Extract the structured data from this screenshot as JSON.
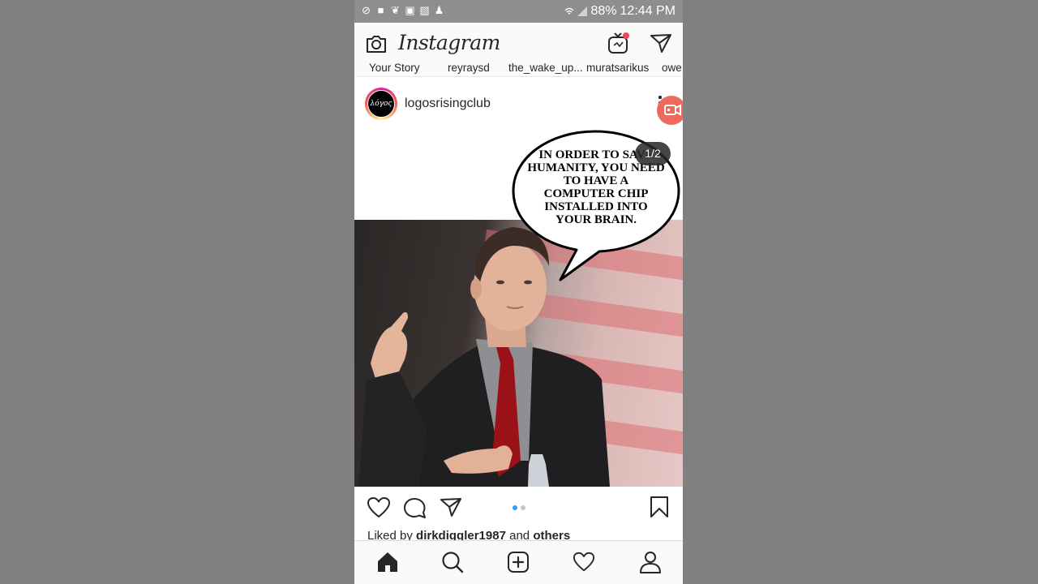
{
  "status_bar": {
    "battery": "88%",
    "time": "12:44 PM",
    "left_icons": [
      "do-not-disturb-icon",
      "video-icon",
      "twitter-icon",
      "clipboard-icon",
      "photo-icon",
      "chess-icon"
    ]
  },
  "header": {
    "logo_text": "Instagram",
    "igtv_badge_color": "#ed4956"
  },
  "stories": [
    {
      "label": "Your Story"
    },
    {
      "label": "reyraysd"
    },
    {
      "label": "the_wake_up..."
    },
    {
      "label": "muratsarikus"
    },
    {
      "label": "owe"
    }
  ],
  "post": {
    "avatar_text": "λόγος",
    "username": "logosrisingclub",
    "counter": "1/2",
    "speech_bubble": "IN ORDER TO SAVE HUMANITY, YOU NEED TO HAVE A COMPUTER CHIP INSTALLED INTO YOUR BRAIN.",
    "carousel_active": 1,
    "carousel_total": 2,
    "likes_prefix": "Liked by",
    "likes_user": "dirkdiggler1987",
    "likes_mid": "and",
    "likes_others": "others"
  },
  "colors": {
    "accent_blue": "#3897f0",
    "video_bubble": "#ee6a5e"
  }
}
